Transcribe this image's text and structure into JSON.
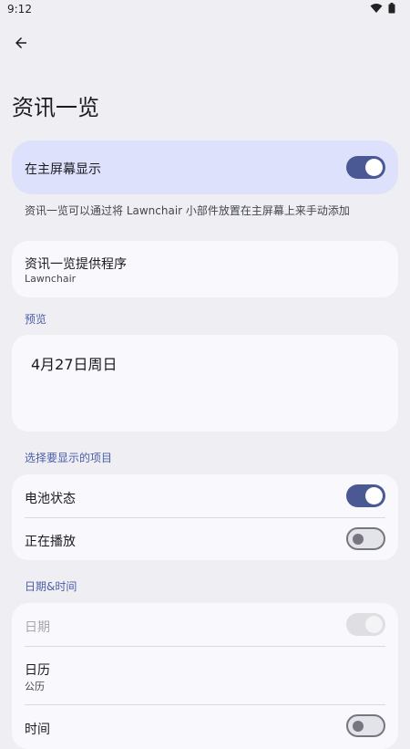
{
  "status": {
    "time": "9:12"
  },
  "title": "资讯一览",
  "show_on_home": {
    "label": "在主屏幕显示",
    "enabled": true
  },
  "helper_text": "资讯一览可以通过将 Lawnchair 小部件放置在主屏幕上来手动添加",
  "provider": {
    "label": "资讯一览提供程序",
    "value": "Lawnchair"
  },
  "preview": {
    "section": "预览",
    "date_text": "4月27日周日"
  },
  "items_section": {
    "header": "选择要显示的项目",
    "items": [
      {
        "label": "电池状态",
        "enabled": true
      },
      {
        "label": "正在播放",
        "enabled": false
      }
    ]
  },
  "datetime_section": {
    "header": "日期&时间",
    "date": {
      "label": "日期",
      "enabled": true,
      "disabled": true
    },
    "calendar": {
      "label": "日历",
      "value": "公历"
    },
    "time": {
      "label": "时间",
      "enabled": false
    }
  }
}
